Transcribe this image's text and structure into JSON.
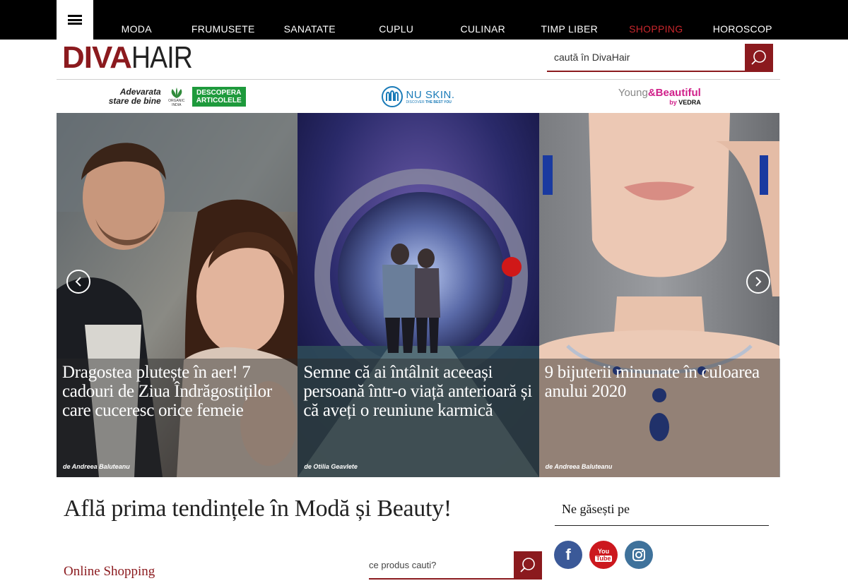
{
  "nav": {
    "menu_icon": "hamburger-icon",
    "items": [
      "MODA",
      "FRUMUSETE",
      "SANATATE",
      "CUPLU",
      "CULINAR",
      "TIMP LIBER",
      "SHOPPING",
      "HOROSCOP"
    ],
    "highlight_color": "#c9262c"
  },
  "header": {
    "logo_bold": "DIVA",
    "logo_light": "HAIR",
    "search_placeholder": "caută în DivaHair",
    "search_icon": "search-icon",
    "brand_color": "#8b1a1e"
  },
  "sponsors": {
    "organic_india": {
      "tagline_1": "Adevarata",
      "tagline_2": "stare de bine",
      "brand_1": "ORGANIC",
      "brand_2": "INDIA",
      "cta_1": "DESCOPERA",
      "cta_2": "ARTICOLELE"
    },
    "nu_skin": {
      "name": "NU SKIN.",
      "slogan_1": "DISCOVER",
      "slogan_2": "THE BEST YOU"
    },
    "young_beautiful": {
      "part_1": "Young",
      "part_2": "&Beautiful",
      "by": "by",
      "vedra": "VEDRA"
    }
  },
  "slider": {
    "slides": [
      {
        "title": "Dragostea plutește în aer! 7 cadouri de Ziua Îndrăgostiților care cuceresc orice femeie",
        "author": "de Andreea Baluteanu"
      },
      {
        "title": "Semne că ai întâlnit aceeași persoană într-o viață anterioară și că aveți o reuniune karmică",
        "author": "de Otilia Geavlete"
      },
      {
        "title": "9 bijuterii minunate în culoarea anului 2020",
        "author": "de Andreea Baluteanu"
      }
    ],
    "prev_icon": "chevron-left-icon",
    "next_icon": "chevron-right-icon"
  },
  "shopping": {
    "headline": "Află prima tendințele în Modă și Beauty!",
    "section_label": "Online Shopping",
    "search_placeholder": "ce produs cauti?"
  },
  "social": {
    "label": "Ne găsești pe",
    "networks": [
      {
        "name": "facebook-icon",
        "color": "#3b5998",
        "glyph": "f"
      },
      {
        "name": "youtube-icon",
        "color": "#cc181e",
        "glyph_1": "You",
        "glyph_2": "Tube"
      },
      {
        "name": "instagram-icon",
        "color": "#3f729b"
      }
    ]
  }
}
